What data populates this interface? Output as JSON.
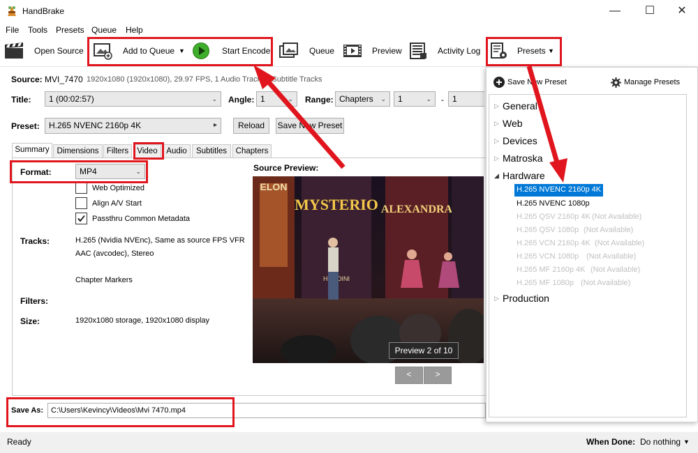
{
  "window": {
    "title": "HandBrake"
  },
  "menu": [
    "File",
    "Tools",
    "Presets",
    "Queue",
    "Help"
  ],
  "toolbar": {
    "open_source": "Open Source",
    "add_to_queue": "Add to Queue",
    "start_encode": "Start Encode",
    "queue": "Queue",
    "preview": "Preview",
    "activity_log": "Activity Log",
    "presets": "Presets"
  },
  "source": {
    "label": "Source:",
    "name": "MVI_7470",
    "info": "1920x1080 (1920x1080), 29.97 FPS, 1 Audio Track, 0 Subtitle Tracks"
  },
  "title_row": {
    "title_label": "Title:",
    "title_value": "1 (00:02:57)",
    "angle_label": "Angle:",
    "angle_value": "1",
    "range_label": "Range:",
    "range_type": "Chapters",
    "range_start": "1",
    "range_sep": "-",
    "range_end": "1"
  },
  "preset_row": {
    "label": "Preset:",
    "value": "H.265 NVENC 2160p 4K",
    "reload": "Reload",
    "save_new": "Save New Preset"
  },
  "tabs": [
    "Summary",
    "Dimensions",
    "Filters",
    "Video",
    "Audio",
    "Subtitles",
    "Chapters"
  ],
  "summary": {
    "format_label": "Format:",
    "format_value": "MP4",
    "web_optimized": {
      "label": "Web Optimized",
      "checked": false
    },
    "align_av": {
      "label": "Align A/V Start",
      "checked": false
    },
    "passthru": {
      "label": "Passthru Common Metadata",
      "checked": true
    },
    "tracks_label": "Tracks:",
    "track_video": "H.265 (Nvidia NVEnc), Same as source FPS VFR",
    "track_audio": "AAC (avcodec), Stereo",
    "chapter_markers": "Chapter Markers",
    "filters_label": "Filters:",
    "size_label": "Size:",
    "size_value": "1920x1080 storage, 1920x1080 display",
    "source_preview_label": "Source Preview:",
    "preview_caption": "Preview 2 of 10",
    "prev_btn": "<",
    "next_btn": ">"
  },
  "preview_image": {
    "sign_left": "MYSTERIO",
    "sign_right": "ALEXANDRA",
    "sign_top": "ELON",
    "sign_small": "HOUDINI"
  },
  "save_as": {
    "label": "Save As:",
    "path": "C:\\Users\\Kevincy\\Videos\\Mvi 7470.mp4"
  },
  "status": {
    "text": "Ready",
    "when_done_label": "When Done:",
    "when_done_value": "Do nothing"
  },
  "preset_panel": {
    "save_new": "Save New Preset",
    "manage": "Manage Presets",
    "groups": [
      "General",
      "Web",
      "Devices",
      "Matroska",
      "Hardware",
      "Production"
    ],
    "hardware_items": [
      {
        "name": "H.265 NVENC 2160p 4K",
        "note": "",
        "available": true,
        "selected": true
      },
      {
        "name": "H.265 NVENC 1080p",
        "note": "",
        "available": true,
        "selected": false
      },
      {
        "name": "H.265 QSV 2160p 4K",
        "note": "(Not Available)",
        "available": false
      },
      {
        "name": "H.265 QSV 1080p",
        "note": "(Not Available)",
        "available": false
      },
      {
        "name": "H.265 VCN 2160p 4K",
        "note": "(Not Available)",
        "available": false
      },
      {
        "name": "H.265 VCN 1080p",
        "note": "(Not Available)",
        "available": false
      },
      {
        "name": "H.265 MF 2160p 4K",
        "note": "(Not Available)",
        "available": false
      },
      {
        "name": "H.265 MF 1080p",
        "note": "(Not Available)",
        "available": false
      }
    ]
  },
  "colors": {
    "highlight_red": "#e0151d",
    "selection_blue": "#0078d7",
    "play_green": "#3fae2a"
  }
}
